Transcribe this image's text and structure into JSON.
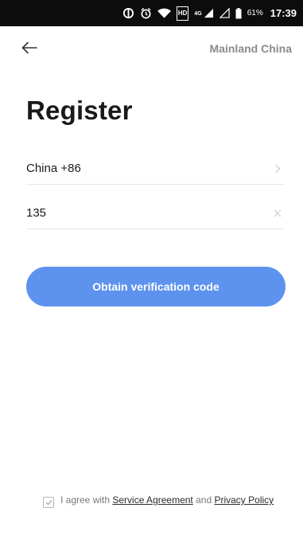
{
  "status_bar": {
    "network_label": "HD",
    "signal_label": "4G",
    "battery_percent": "61%",
    "time": "17:39",
    "icons": [
      "data-saver-icon",
      "alarm-icon",
      "wifi-icon",
      "hd-volte-icon",
      "cellular-signal-icon",
      "cellular-signal-icon",
      "battery-icon"
    ]
  },
  "header": {
    "back_icon": "arrow-left-icon",
    "region": "Mainland China"
  },
  "page": {
    "title": "Register"
  },
  "form": {
    "country": "China +86",
    "country_icon": "chevron-right-icon",
    "phone_value": "135",
    "clear_icon": "close-icon",
    "submit_label": "Obtain verification code",
    "accent_color": "#5d93ee"
  },
  "agreement": {
    "prefix": "I agree with ",
    "service_link": "Service Agreement",
    "middle": " and ",
    "privacy_link": "Privacy Policy",
    "checked": true
  }
}
